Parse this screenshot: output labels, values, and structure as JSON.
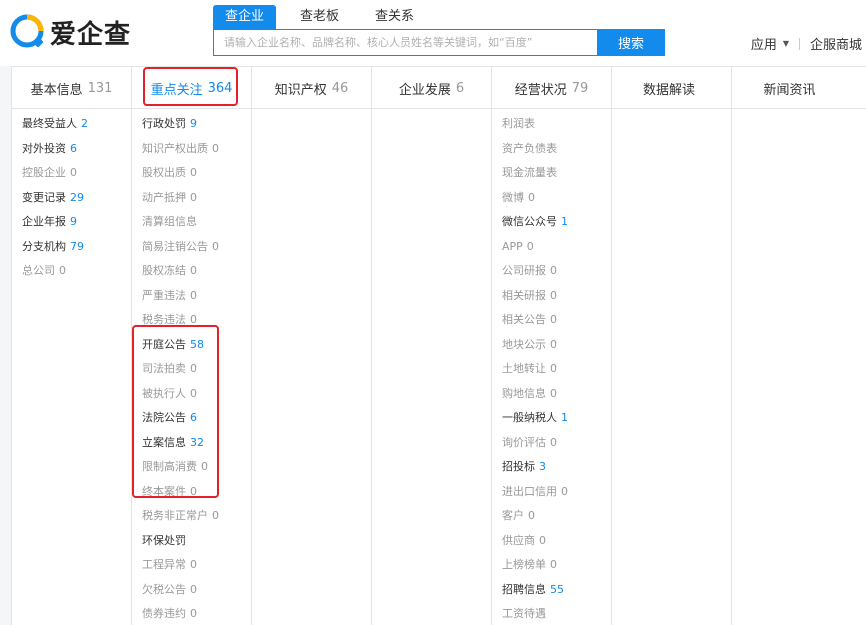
{
  "brand": {
    "name": "爱企查",
    "accent": "#128bed",
    "highlight": "#e4202b"
  },
  "search": {
    "tabs": [
      "查企业",
      "查老板",
      "查关系"
    ],
    "placeholder": "请输入企业名称、品牌名称、核心人员姓名等关键词，如“百度”",
    "button": "搜索"
  },
  "header": {
    "apps": "应用",
    "mall": "企服商城"
  },
  "categories": [
    {
      "label": "基本信息",
      "count": "131"
    },
    {
      "label": "重点关注",
      "count": "364"
    },
    {
      "label": "知识产权",
      "count": "46"
    },
    {
      "label": "企业发展",
      "count": "6"
    },
    {
      "label": "经营状况",
      "count": "79"
    },
    {
      "label": "数据解读",
      "count": ""
    },
    {
      "label": "新闻资讯",
      "count": ""
    }
  ],
  "columns": {
    "basic": [
      {
        "label": "最终受益人",
        "count": "2"
      },
      {
        "label": "对外投资",
        "count": "6"
      },
      {
        "label": "控股企业",
        "count": "0"
      },
      {
        "label": "变更记录",
        "count": "29"
      },
      {
        "label": "企业年报",
        "count": "9"
      },
      {
        "label": "分支机构",
        "count": "79"
      },
      {
        "label": "总公司",
        "count": "0"
      }
    ],
    "focus": [
      {
        "label": "行政处罚",
        "count": "9"
      },
      {
        "label": "知识产权出质",
        "count": "0"
      },
      {
        "label": "股权出质",
        "count": "0"
      },
      {
        "label": "动产抵押",
        "count": "0"
      },
      {
        "label": "清算组信息",
        "count": ""
      },
      {
        "label": "简易注销公告",
        "count": "0"
      },
      {
        "label": "股权冻结",
        "count": "0"
      },
      {
        "label": "严重违法",
        "count": "0"
      },
      {
        "label": "税务违法",
        "count": "0"
      },
      {
        "label": "开庭公告",
        "count": "58"
      },
      {
        "label": "司法拍卖",
        "count": "0"
      },
      {
        "label": "被执行人",
        "count": "0"
      },
      {
        "label": "法院公告",
        "count": "6"
      },
      {
        "label": "立案信息",
        "count": "32"
      },
      {
        "label": "限制高消费",
        "count": "0"
      },
      {
        "label": "终本案件",
        "count": "0"
      },
      {
        "label": "税务非正常户",
        "count": "0"
      },
      {
        "label": "环保处罚",
        "count": ""
      },
      {
        "label": "工程异常",
        "count": "0"
      },
      {
        "label": "欠税公告",
        "count": "0"
      },
      {
        "label": "债券违约",
        "count": "0"
      }
    ],
    "operations": [
      {
        "label": "利润表",
        "count": ""
      },
      {
        "label": "资产负债表",
        "count": ""
      },
      {
        "label": "现金流量表",
        "count": ""
      },
      {
        "label": "微博",
        "count": "0"
      },
      {
        "label": "微信公众号",
        "count": "1"
      },
      {
        "label": "APP",
        "count": "0"
      },
      {
        "label": "公司研报",
        "count": "0"
      },
      {
        "label": "相关研报",
        "count": "0"
      },
      {
        "label": "相关公告",
        "count": "0"
      },
      {
        "label": "地块公示",
        "count": "0"
      },
      {
        "label": "土地转让",
        "count": "0"
      },
      {
        "label": "购地信息",
        "count": "0"
      },
      {
        "label": "一般纳税人",
        "count": "1"
      },
      {
        "label": "询价评估",
        "count": "0"
      },
      {
        "label": "招投标",
        "count": "3"
      },
      {
        "label": "进出口信用",
        "count": "0"
      },
      {
        "label": "客户",
        "count": "0"
      },
      {
        "label": "供应商",
        "count": "0"
      },
      {
        "label": "上榜榜单",
        "count": "0"
      },
      {
        "label": "招聘信息",
        "count": "55"
      },
      {
        "label": "工资待遇",
        "count": ""
      }
    ]
  }
}
